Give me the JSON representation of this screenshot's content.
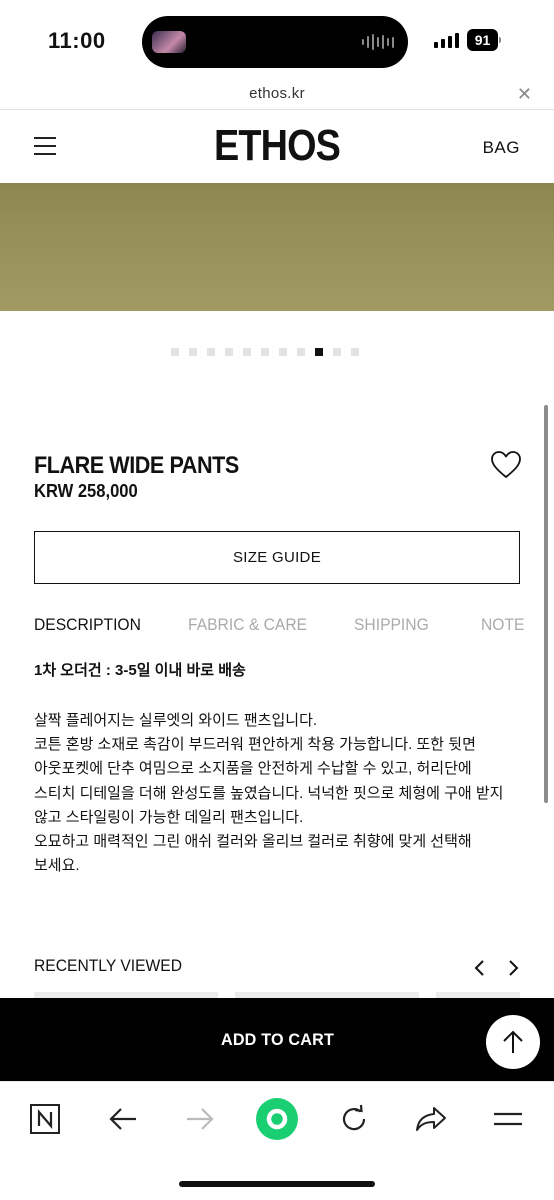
{
  "status_bar": {
    "time": "11:00",
    "battery": "91",
    "icons": [
      "media-thumbnail-icon",
      "waveform-icon",
      "signal-icon",
      "battery-icon"
    ]
  },
  "browser": {
    "url": "ethos.kr",
    "close_icon": "close-icon"
  },
  "header": {
    "menu_icon": "hamburger-menu-icon",
    "logo": "ETHOS",
    "bag_label": "BAG"
  },
  "gallery": {
    "total_slides": 11,
    "active_slide_index": 8,
    "image_color": "#958f5a"
  },
  "product": {
    "name": "FLARE WIDE PANTS",
    "price": "KRW 258,000",
    "wishlist_icon": "heart-icon",
    "size_guide_label": "SIZE GUIDE"
  },
  "tabs": [
    {
      "label": "DESCRIPTION",
      "active": true
    },
    {
      "label": "FABRIC & CARE",
      "active": false
    },
    {
      "label": "SHIPPING",
      "active": false
    },
    {
      "label": "NOTE",
      "active": false
    }
  ],
  "description": {
    "shipping_note": "1차 오더건 : 3-5일 이내 바로 배송",
    "lines": [
      "살짝 플레어지는 실루엣의 와이드 팬츠입니다.",
      "코튼 혼방 소재로 촉감이 부드러워 편안하게 착용 가능합니다. 또한 뒷면",
      "아웃포켓에 단추 여밈으로 소지품을 안전하게 수납할 수 있고, 허리단에",
      "스티치 디테일을 더해 완성도를 높였습니다. 넉넉한 핏으로 체형에 구애 받지",
      "않고 스타일링이 가능한 데일리 팬츠입니다.",
      "오묘하고 매력적인 그린 애쉬 컬러와 올리브 컬러로 취향에 맞게 선택해",
      "보세요."
    ]
  },
  "recently_viewed": {
    "label": "RECENTLY VIEWED",
    "prev_icon": "chevron-left-icon",
    "next_icon": "chevron-right-icon"
  },
  "cart": {
    "add_label": "ADD TO CART",
    "scroll_top_icon": "arrow-up-icon"
  },
  "toolbar": {
    "icons": [
      "naver-home-icon",
      "back-arrow-icon",
      "forward-arrow-icon",
      "green-dot-icon",
      "reload-icon",
      "share-icon",
      "menu-icon"
    ],
    "accent_color": "#19cf72"
  }
}
